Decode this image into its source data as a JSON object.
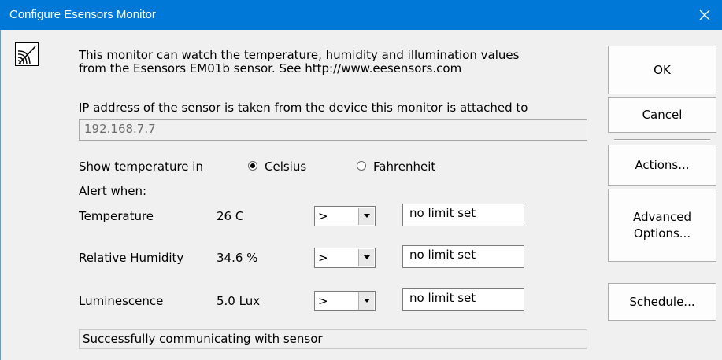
{
  "window": {
    "title": "Configure Esensors Monitor",
    "close_glyph": "✕"
  },
  "description": {
    "line1": "This monitor can watch the temperature, humidity and illumination values",
    "line2": "from the Esensors EM01b sensor.  See http://www.eesensors.com"
  },
  "ip": {
    "label": "IP address of the sensor is taken from the device this monitor is attached to",
    "value": "192.168.7.7"
  },
  "temperature_unit": {
    "label": "Show temperature in",
    "options": [
      {
        "label": "Celsius",
        "selected": true
      },
      {
        "label": "Fahrenheit",
        "selected": false
      }
    ]
  },
  "alert_label": "Alert when:",
  "rows": [
    {
      "name": "Temperature",
      "value": "26 C",
      "operator": ">",
      "limit": "no limit set"
    },
    {
      "name": "Relative Humidity",
      "value": "34.6 %",
      "operator": ">",
      "limit": "no limit set"
    },
    {
      "name": "Luminescence",
      "value": "5.0 Lux",
      "operator": ">",
      "limit": "no limit set"
    }
  ],
  "status": "Successfully communicating with sensor",
  "buttons": {
    "ok": "OK",
    "cancel": "Cancel",
    "actions": "Actions...",
    "advanced_line1": "Advanced",
    "advanced_line2": "Options...",
    "schedule": "Schedule..."
  },
  "icons": {
    "title_close": "close-icon",
    "monitor": "sensor-waves-icon",
    "combo_arrow": "chevron-down-icon"
  },
  "colors": {
    "titlebar": "#0078d7",
    "client": "#f0f0f0"
  }
}
